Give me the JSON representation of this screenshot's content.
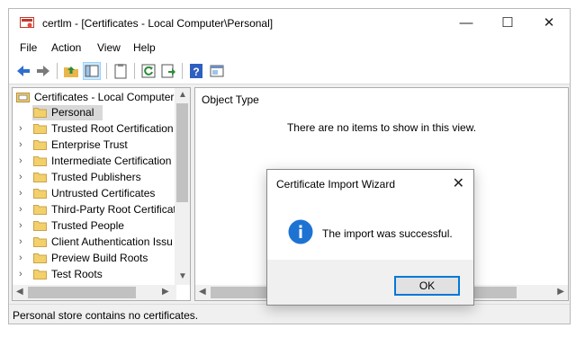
{
  "window": {
    "title": "certlm - [Certificates - Local Computer\\Personal]",
    "controls": {
      "minimize": "—",
      "maximize": "☐",
      "close": "✕"
    }
  },
  "menu": [
    "File",
    "Action",
    "View",
    "Help"
  ],
  "toolbar_icons": [
    "back-arrow-icon",
    "forward-arrow-icon",
    "up-folder-icon",
    "show-hide-tree-icon",
    "clipboard-icon",
    "refresh-icon",
    "export-list-icon",
    "help-icon",
    "properties-icon"
  ],
  "tree": {
    "root": "Certificates - Local Computer",
    "items": [
      {
        "label": "Personal",
        "selected": true,
        "expandable": false
      },
      {
        "label": "Trusted Root Certification",
        "expandable": true
      },
      {
        "label": "Enterprise Trust",
        "expandable": true
      },
      {
        "label": "Intermediate Certification",
        "expandable": true
      },
      {
        "label": "Trusted Publishers",
        "expandable": true
      },
      {
        "label": "Untrusted Certificates",
        "expandable": true
      },
      {
        "label": "Third-Party Root Certificat",
        "expandable": true
      },
      {
        "label": "Trusted People",
        "expandable": true
      },
      {
        "label": "Client Authentication Issu",
        "expandable": true
      },
      {
        "label": "Preview Build Roots",
        "expandable": true
      },
      {
        "label": "Test Roots",
        "expandable": true
      }
    ]
  },
  "content": {
    "column_header": "Object Type",
    "empty_message": "There are no items to show in this view."
  },
  "status": "Personal store contains no certificates.",
  "dialog": {
    "title": "Certificate Import Wizard",
    "message": "The import was successful.",
    "ok_label": "OK",
    "close": "✕"
  },
  "colors": {
    "accent": "#0078d7",
    "info_icon": "#1e73d2",
    "folder": "#f3d06b"
  }
}
